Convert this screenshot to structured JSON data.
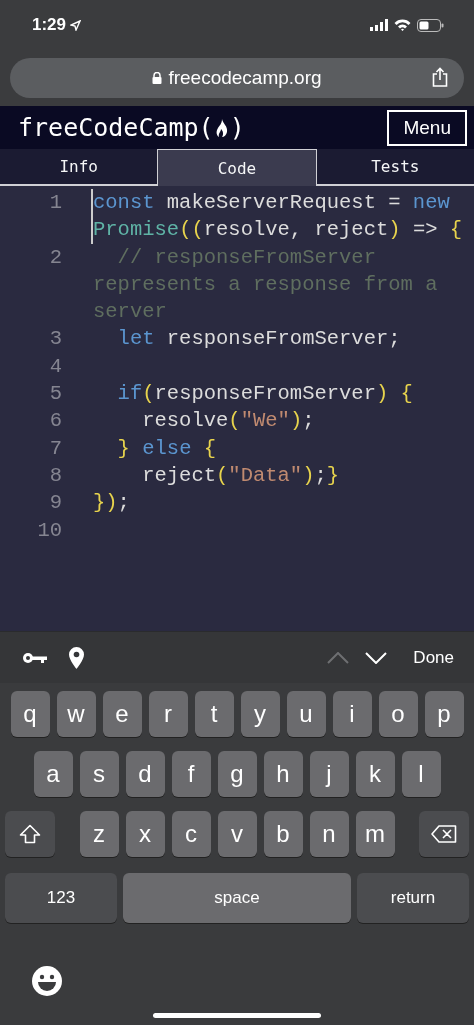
{
  "status_bar": {
    "time": "1:29"
  },
  "browser": {
    "url": "freecodecamp.org"
  },
  "header": {
    "logo_start": "freeCodeCamp(",
    "logo_end": ")",
    "menu": "Menu"
  },
  "tabs": [
    {
      "label": "Info",
      "selected": false
    },
    {
      "label": "Code",
      "selected": true
    },
    {
      "label": "Tests",
      "selected": false
    }
  ],
  "editor": {
    "lines": [
      {
        "number": "1",
        "tokens": [
          {
            "kind": "keyword",
            "text": "const"
          },
          {
            "kind": "plain",
            "text": " makeServerRequest = "
          },
          {
            "kind": "keyword",
            "text": "new"
          },
          {
            "kind": "type",
            "text": " Promise"
          },
          {
            "kind": "bracket",
            "text": "(("
          },
          {
            "kind": "plain",
            "text": "resolve, reject"
          },
          {
            "kind": "bracket",
            "text": ")"
          },
          {
            "kind": "plain",
            "text": " => "
          },
          {
            "kind": "bracket",
            "text": "{"
          }
        ]
      },
      {
        "number": "2",
        "tokens": [
          {
            "kind": "comment",
            "text": "  // responseFromServer represents a response from a server"
          }
        ]
      },
      {
        "number": "3",
        "tokens": [
          {
            "kind": "keyword",
            "text": "  let"
          },
          {
            "kind": "plain",
            "text": " responseFromServer;"
          }
        ]
      },
      {
        "number": "4"
      },
      {
        "number": "5",
        "tokens": [
          {
            "kind": "keyword",
            "text": "  if"
          },
          {
            "kind": "bracket",
            "text": "("
          },
          {
            "kind": "plain",
            "text": "responseFromServer"
          },
          {
            "kind": "bracket",
            "text": ")"
          },
          {
            "kind": "bracket",
            "text": " {"
          }
        ]
      },
      {
        "number": "6",
        "tokens": [
          {
            "kind": "plain",
            "text": "    resolve"
          },
          {
            "kind": "bracket",
            "text": "("
          },
          {
            "kind": "string",
            "text": "\"We\""
          },
          {
            "kind": "bracket",
            "text": ")"
          },
          {
            "kind": "plain",
            "text": ";"
          }
        ]
      },
      {
        "number": "7",
        "tokens": [
          {
            "kind": "bracket",
            "text": "  }"
          },
          {
            "kind": "keyword",
            "text": " else"
          },
          {
            "kind": "bracket",
            "text": " {"
          }
        ]
      },
      {
        "number": "8",
        "tokens": [
          {
            "kind": "plain",
            "text": "    reject"
          },
          {
            "kind": "bracket",
            "text": "("
          },
          {
            "kind": "string",
            "text": "\"Data\""
          },
          {
            "kind": "bracket",
            "text": ")"
          },
          {
            "kind": "plain",
            "text": ";"
          },
          {
            "kind": "bracket",
            "text": "}"
          }
        ]
      },
      {
        "number": "9",
        "tokens": [
          {
            "kind": "bracket",
            "text": "})"
          },
          {
            "kind": "plain",
            "text": ";"
          }
        ]
      },
      {
        "number": "10"
      }
    ]
  },
  "keyboard_toolbar": {
    "nav": [
      {
        "kind": "previous",
        "disabled": true
      },
      {
        "kind": "next",
        "disabled": false
      }
    ],
    "done": "Done"
  },
  "keyboard": {
    "top_row": [
      "q",
      "w",
      "e",
      "r",
      "t",
      "y",
      "u",
      "i",
      "o",
      "p"
    ],
    "middle_row": [
      "a",
      "s",
      "d",
      "f",
      "g",
      "h",
      "j",
      "k",
      "l"
    ],
    "bottom_row": [
      "z",
      "x",
      "c",
      "v",
      "b",
      "n",
      "m"
    ],
    "numbers_key": "123",
    "space_key": "space",
    "return_key": "return"
  }
}
